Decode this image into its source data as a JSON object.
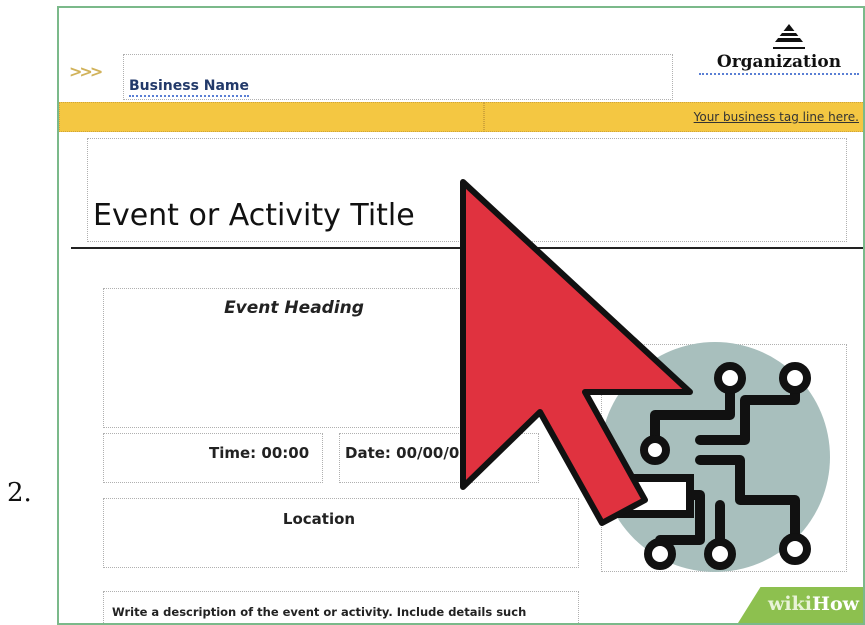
{
  "step_number": "2.",
  "header": {
    "business_name": "Business Name",
    "organization": "Organization",
    "tagline": "Your business tag line here."
  },
  "event": {
    "title": "Event or Activity Title",
    "heading": "Event Heading",
    "time": "Time: 00:00",
    "date": "Date: 00/00/0",
    "location": "Location",
    "description": "Write a description of the event or activity. Include details such"
  },
  "watermark": {
    "wiki": "wiki",
    "how": "How"
  },
  "colors": {
    "tag_bar": "#f4c742",
    "cursor_red": "#e0323f",
    "circle": "#a8bfbd",
    "wikihow_green": "#8dc04f"
  },
  "icons": [
    "chevrons-icon",
    "organization-logo-icon",
    "cursor-arrow-icon",
    "circuit-icon"
  ]
}
